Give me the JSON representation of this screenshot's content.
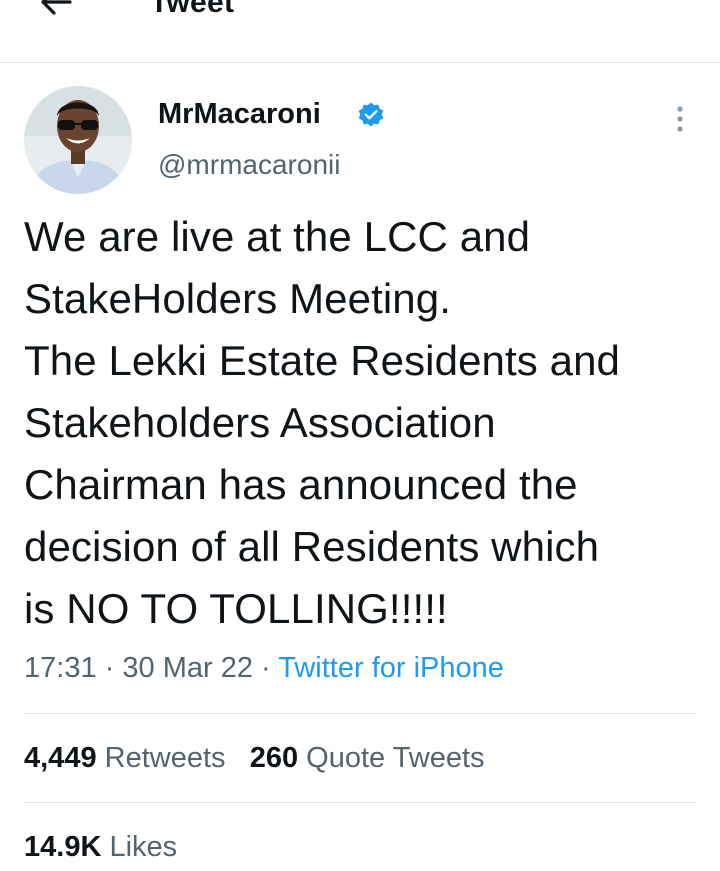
{
  "header": {
    "title": "Tweet"
  },
  "tweet": {
    "author": {
      "display_name": "MrMacaroni",
      "handle": "@mrmacaronii",
      "verified": true
    },
    "text": "We are live at the LCC and\nStakeHolders Meeting.\nThe Lekki Estate Residents and\nStakeholders Association\nChairman has announced the\ndecision of all Residents which\nis NO TO TOLLING!!!!!",
    "time": "17:31",
    "date": "30 Mar 22",
    "separator": "·",
    "source": "Twitter for iPhone",
    "stats": {
      "retweets_count": "4,449",
      "retweets_label": "Retweets",
      "quotes_count": "260",
      "quotes_label": "Quote Tweets",
      "likes_count": "14.9K",
      "likes_label": "Likes"
    }
  },
  "colors": {
    "accent": "#1d9bf0",
    "text": "#0f1419",
    "secondary": "#536471",
    "divider": "#e6e9eb"
  },
  "icons": {
    "back": "arrow-left-icon",
    "verified": "verified-badge-icon",
    "more": "more-vertical-icon"
  }
}
